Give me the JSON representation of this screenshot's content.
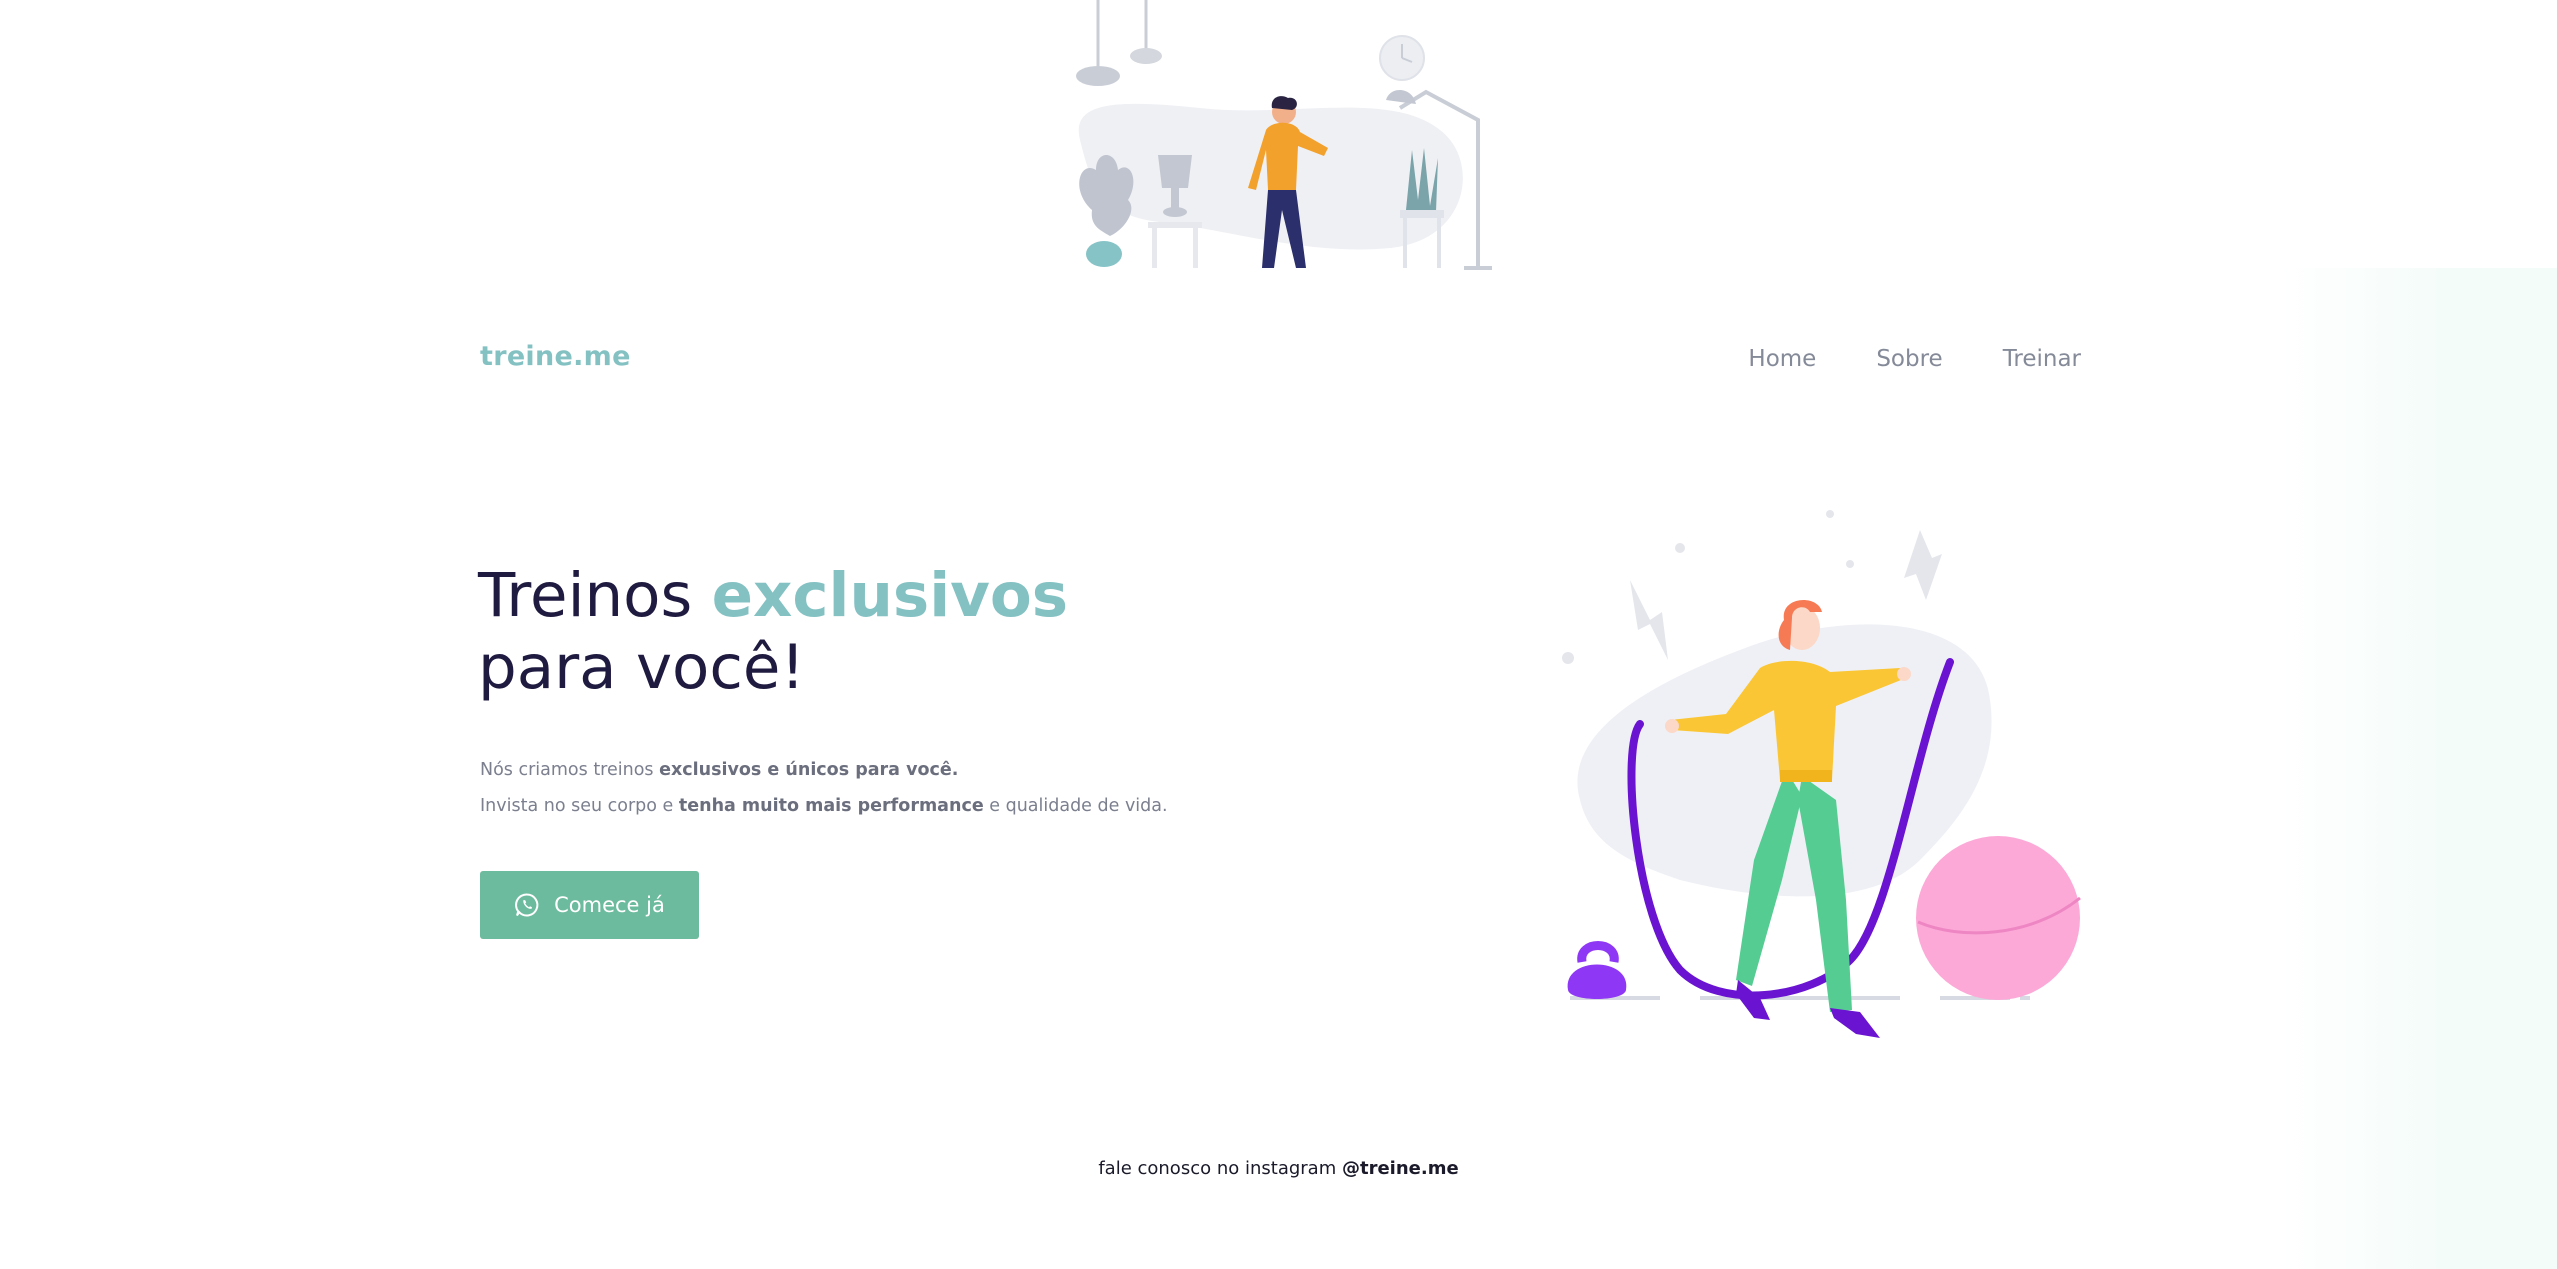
{
  "brand": {
    "logo": "treine.me",
    "accent_color": "#84c1c3",
    "button_color": "#6dbb9e"
  },
  "nav": {
    "items": [
      {
        "label": "Home"
      },
      {
        "label": "Sobre"
      },
      {
        "label": "Treinar"
      }
    ]
  },
  "hero": {
    "title_part1": "Treinos ",
    "title_accent": "exclusivos",
    "title_part2": "para você!",
    "desc_line1_prefix": "Nós criamos treinos ",
    "desc_line1_bold": "exclusivos e únicos para você.",
    "desc_line2_prefix": "Invista no seu corpo e ",
    "desc_line2_bold": "tenha muito mais performance",
    "desc_line2_suffix": " e qualidade de vida.",
    "cta_label": "Comece já",
    "cta_icon": "whatsapp-icon"
  },
  "footer": {
    "prefix": "fale conosco no instagram ",
    "handle": "@treine.me"
  }
}
